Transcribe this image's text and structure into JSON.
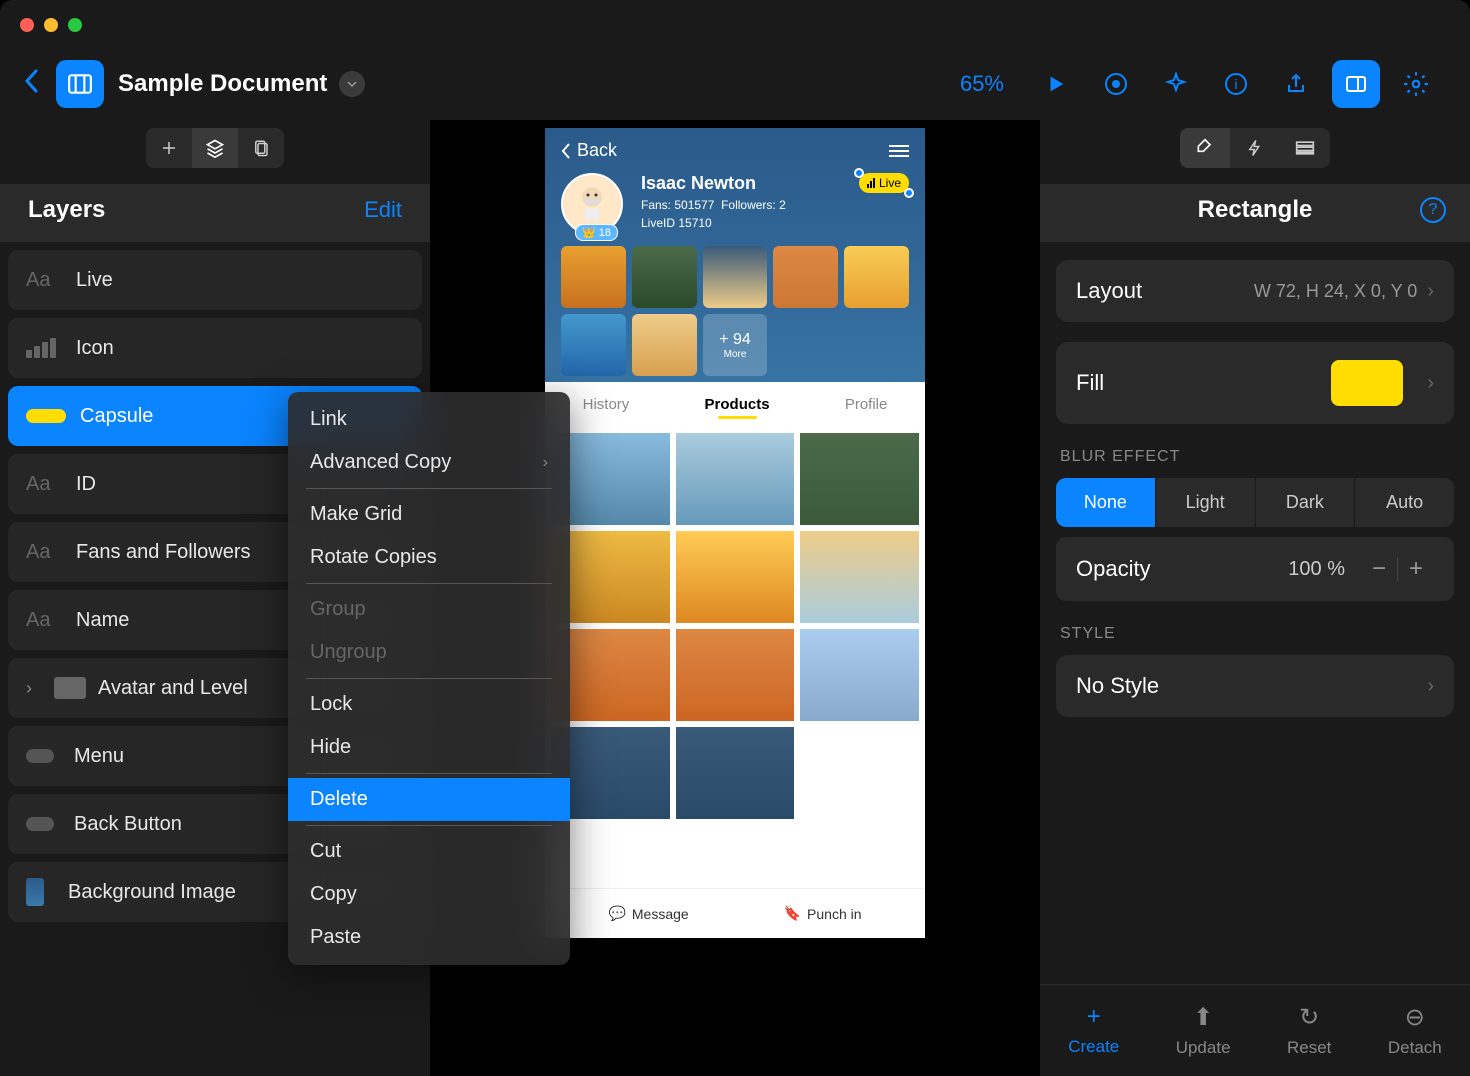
{
  "toolbar": {
    "doc_title": "Sample Document",
    "zoom": "65%"
  },
  "left_panel": {
    "title": "Layers",
    "edit": "Edit",
    "layers": [
      {
        "label": "Live",
        "icon": "text"
      },
      {
        "label": "Icon",
        "icon": "bars"
      },
      {
        "label": "Capsule",
        "icon": "capsule",
        "selected": true
      },
      {
        "label": "ID",
        "icon": "text"
      },
      {
        "label": "Fans and Followers",
        "icon": "text"
      },
      {
        "label": "Name",
        "icon": "text"
      },
      {
        "label": "Avatar and Level",
        "icon": "folder",
        "expandable": true
      },
      {
        "label": "Menu",
        "icon": "pill"
      },
      {
        "label": "Back Button",
        "icon": "pill"
      },
      {
        "label": "Background Image",
        "icon": "image"
      }
    ]
  },
  "context_menu": {
    "items": [
      {
        "label": "Link",
        "type": "item"
      },
      {
        "label": "Advanced Copy",
        "type": "submenu"
      },
      {
        "type": "divider"
      },
      {
        "label": "Make Grid",
        "type": "item"
      },
      {
        "label": "Rotate Copies",
        "type": "item"
      },
      {
        "type": "divider"
      },
      {
        "label": "Group",
        "type": "item",
        "disabled": true
      },
      {
        "label": "Ungroup",
        "type": "item",
        "disabled": true
      },
      {
        "type": "divider"
      },
      {
        "label": "Lock",
        "type": "item"
      },
      {
        "label": "Hide",
        "type": "item"
      },
      {
        "type": "divider"
      },
      {
        "label": "Delete",
        "type": "item",
        "highlighted": true
      },
      {
        "type": "divider"
      },
      {
        "label": "Cut",
        "type": "item"
      },
      {
        "label": "Copy",
        "type": "item"
      },
      {
        "label": "Paste",
        "type": "item"
      }
    ]
  },
  "canvas": {
    "back": "Back",
    "live_badge": "Live",
    "name": "Isaac Newton",
    "fans_label": "Fans:",
    "fans": "501577",
    "followers_label": "Followers:",
    "followers": "2",
    "liveid_label": "LiveID",
    "liveid": "15710",
    "level": "18",
    "more_count": "+ 94",
    "more_label": "More",
    "tabs": [
      "History",
      "Products",
      "Profile"
    ],
    "active_tab": 1,
    "action_message": "Message",
    "action_punchin": "Punch in"
  },
  "right_panel": {
    "title": "Rectangle",
    "layout_label": "Layout",
    "layout_value": "W 72, H 24, X 0, Y 0",
    "fill_label": "Fill",
    "fill_color": "#ffdd00",
    "blur_label": "BLUR EFFECT",
    "blur_options": [
      "None",
      "Light",
      "Dark",
      "Auto"
    ],
    "blur_active": 0,
    "opacity_label": "Opacity",
    "opacity_value": "100 %",
    "style_label": "STYLE",
    "style_value": "No Style",
    "actions": [
      {
        "label": "Create",
        "icon": "+",
        "active": true
      },
      {
        "label": "Update",
        "icon": "↑"
      },
      {
        "label": "Reset",
        "icon": "↻"
      },
      {
        "label": "Detach",
        "icon": "⊖"
      }
    ]
  }
}
